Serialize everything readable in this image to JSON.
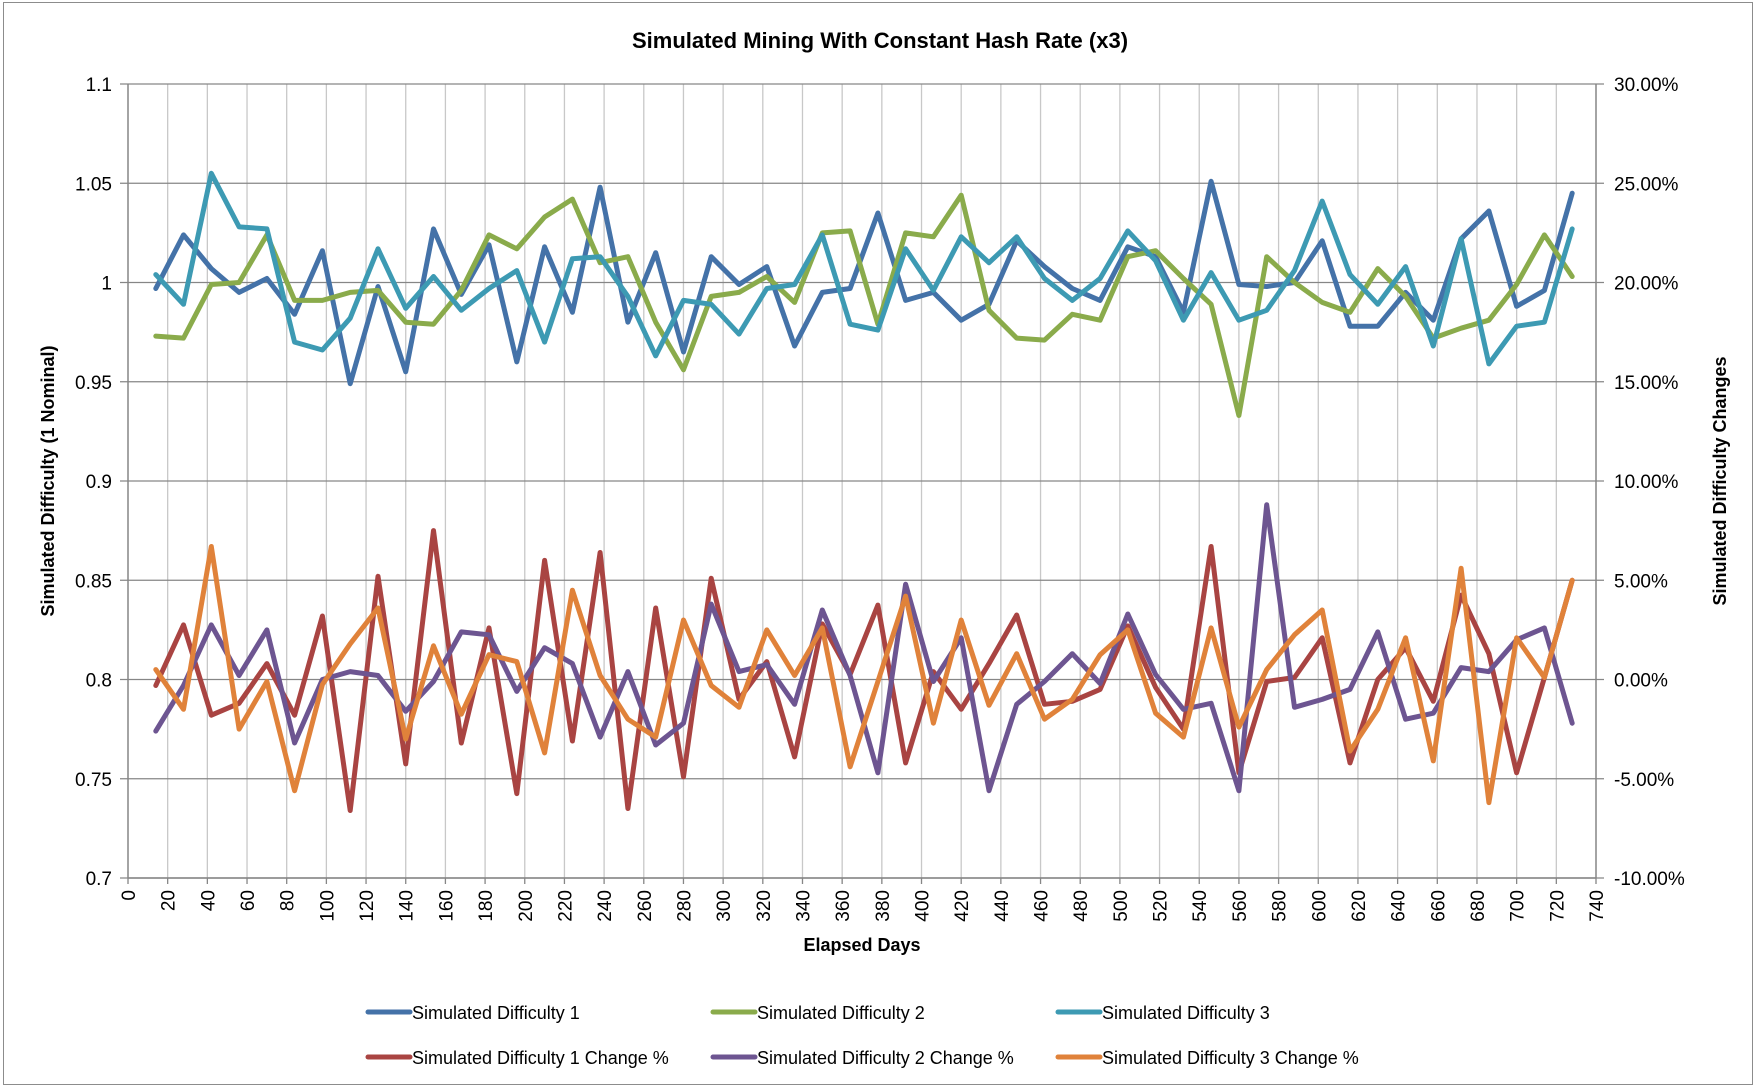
{
  "chart_data": {
    "type": "line",
    "title": "Simulated Mining With Constant Hash Rate (x3)",
    "xlabel": "Elapsed Days",
    "ylabel": "Simulated Difficulty (1 Nominal)",
    "y2label": "Simulated Difficulty Changes",
    "xlim": [
      0,
      740
    ],
    "ylim": [
      0.7,
      1.1
    ],
    "y2lim": [
      -10,
      30
    ],
    "grid": true,
    "legend_position": "bottom",
    "x_ticks": [
      "0",
      "20",
      "40",
      "60",
      "80",
      "100",
      "120",
      "140",
      "160",
      "180",
      "200",
      "220",
      "240",
      "260",
      "280",
      "300",
      "320",
      "340",
      "360",
      "380",
      "400",
      "420",
      "440",
      "460",
      "480",
      "500",
      "520",
      "540",
      "560",
      "580",
      "600",
      "620",
      "640",
      "660",
      "680",
      "700",
      "720",
      "740"
    ],
    "y_ticks": [
      "0.7",
      "0.75",
      "0.8",
      "0.85",
      "0.9",
      "0.95",
      "1",
      "1.05",
      "1.1"
    ],
    "y2_ticks": [
      "-10.00%",
      "-5.00%",
      "0.00%",
      "5.00%",
      "10.00%",
      "15.00%",
      "20.00%",
      "25.00%",
      "30.00%"
    ],
    "x": [
      14,
      28,
      42,
      56,
      70,
      84,
      98,
      112,
      126,
      140,
      154,
      168,
      182,
      196,
      210,
      224,
      238,
      252,
      266,
      280,
      294,
      308,
      322,
      336,
      350,
      364,
      378,
      392,
      406,
      420,
      434,
      448,
      462,
      476,
      490,
      504,
      518,
      532,
      546,
      560,
      574,
      588,
      602,
      616,
      630,
      644,
      658,
      672,
      686,
      700,
      714,
      728
    ],
    "series": [
      {
        "name": "Simulated Difficulty 1",
        "axis": "left",
        "color": "#4472a8",
        "values": [
          0.997,
          1.024,
          1.007,
          0.995,
          1.002,
          0.984,
          1.016,
          0.949,
          0.998,
          0.955,
          1.027,
          0.994,
          1.019,
          0.96,
          1.018,
          0.985,
          1.048,
          0.98,
          1.015,
          0.965,
          1.013,
          0.999,
          1.008,
          0.968,
          0.995,
          0.997,
          1.035,
          0.991,
          0.995,
          0.981,
          0.989,
          1.021,
          1.008,
          0.997,
          0.991,
          1.018,
          1.013,
          0.985,
          1.051,
          0.999,
          0.998,
          1.0,
          1.021,
          0.978,
          0.978,
          0.995,
          0.981,
          1.022,
          1.036,
          0.988,
          0.996,
          1.045
        ]
      },
      {
        "name": "Simulated Difficulty 2",
        "axis": "left",
        "color": "#8aab4b",
        "values": [
          0.973,
          0.972,
          0.999,
          1.0,
          1.024,
          0.991,
          0.991,
          0.995,
          0.996,
          0.98,
          0.979,
          0.996,
          1.024,
          1.017,
          1.033,
          1.042,
          1.01,
          1.013,
          0.98,
          0.956,
          0.993,
          0.995,
          1.003,
          0.99,
          1.025,
          1.026,
          0.979,
          1.025,
          1.023,
          1.044,
          0.986,
          0.972,
          0.971,
          0.984,
          0.981,
          1.013,
          1.016,
          1.002,
          0.989,
          0.933,
          1.013,
          1.0,
          0.99,
          0.985,
          1.007,
          0.993,
          0.972,
          0.977,
          0.981,
          0.999,
          1.024,
          1.003
        ]
      },
      {
        "name": "Simulated Difficulty 3",
        "axis": "left",
        "color": "#3d9ab3",
        "values": [
          1.004,
          0.989,
          1.055,
          1.028,
          1.027,
          0.97,
          0.966,
          0.982,
          1.017,
          0.987,
          1.003,
          0.986,
          0.997,
          1.006,
          0.97,
          1.012,
          1.013,
          0.993,
          0.963,
          0.991,
          0.989,
          0.974,
          0.997,
          0.999,
          1.024,
          0.979,
          0.976,
          1.017,
          0.996,
          1.023,
          1.01,
          1.023,
          1.002,
          0.991,
          1.002,
          1.026,
          1.011,
          0.981,
          1.005,
          0.981,
          0.986,
          1.006,
          1.041,
          1.004,
          0.989,
          1.008,
          0.968,
          1.022,
          0.959,
          0.978,
          0.98,
          1.027
        ]
      },
      {
        "name": "Simulated Difficulty 1 Change %",
        "axis": "right",
        "color": "#a94442",
        "values": [
          -0.3,
          2.75,
          -1.8,
          -1.2,
          0.8,
          -1.8,
          3.2,
          -6.6,
          5.2,
          -4.25,
          7.5,
          -3.2,
          2.6,
          -5.75,
          6.0,
          -3.1,
          6.4,
          -6.5,
          3.6,
          -4.9,
          5.1,
          -1.0,
          0.9,
          -3.9,
          2.8,
          0.25,
          3.75,
          -4.2,
          0.4,
          -1.5,
          0.8,
          3.25,
          -1.25,
          -1.1,
          -0.5,
          2.7,
          -0.4,
          -2.5,
          6.7,
          -4.7,
          -0.1,
          0.1,
          2.1,
          -4.2,
          0.0,
          1.6,
          -1.1,
          4.25,
          1.3,
          -4.7,
          0.1,
          5.0
        ]
      },
      {
        "name": "Simulated Difficulty 2 Change %",
        "axis": "right",
        "color": "#6d5591",
        "values": [
          -2.6,
          -0.3,
          2.75,
          0.2,
          2.5,
          -3.2,
          0.0,
          0.4,
          0.2,
          -1.6,
          -0.1,
          2.4,
          2.25,
          -0.6,
          1.6,
          0.8,
          -2.9,
          0.4,
          -3.3,
          -2.2,
          3.8,
          0.4,
          0.75,
          -1.25,
          3.5,
          0.2,
          -4.7,
          4.8,
          -0.1,
          2.1,
          -5.6,
          -1.25,
          -0.1,
          1.3,
          -0.2,
          3.3,
          0.25,
          -1.5,
          -1.2,
          -5.6,
          8.8,
          -1.4,
          -1.0,
          -0.5,
          2.4,
          -2.0,
          -1.7,
          0.6,
          0.4,
          2.0,
          2.6,
          -2.2
        ]
      },
      {
        "name": "Simulated Difficulty 3 Change %",
        "axis": "right",
        "color": "#e0823a",
        "values": [
          0.5,
          -1.5,
          6.7,
          -2.5,
          -0.1,
          -5.6,
          -0.25,
          1.8,
          3.6,
          -3.0,
          1.7,
          -1.75,
          1.25,
          0.9,
          -3.7,
          4.5,
          0.2,
          -2.0,
          -2.9,
          3.0,
          -0.3,
          -1.4,
          2.5,
          0.2,
          2.6,
          -4.4,
          -0.1,
          4.2,
          -2.2,
          3.0,
          -1.3,
          1.3,
          -2.0,
          -1.0,
          1.25,
          2.5,
          -1.7,
          -2.9,
          2.6,
          -2.4,
          0.5,
          2.25,
          3.5,
          -3.6,
          -1.5,
          2.1,
          -4.1,
          5.6,
          -6.2,
          2.1,
          0.1,
          5.0
        ]
      }
    ]
  }
}
